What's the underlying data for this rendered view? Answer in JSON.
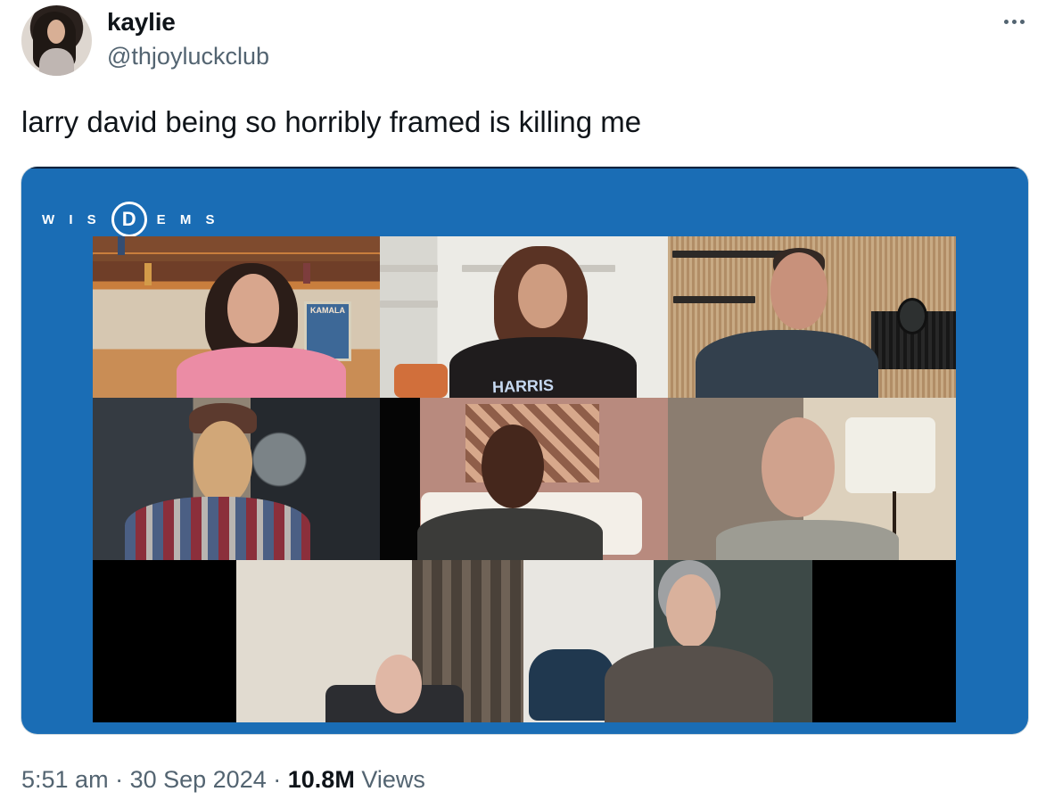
{
  "tweet": {
    "author_name": "kaylie",
    "author_handle": "@thjoyluckclub",
    "text": "larry david being so horribly framed is killing me",
    "time": "5:51 am",
    "separator": "·",
    "date": "30 Sep 2024",
    "views_count": "10.8M",
    "views_label": "Views"
  },
  "media": {
    "brand_prefix": "W I S",
    "brand_mark": "D",
    "brand_suffix": "E M S",
    "shirt_text": "HARRIS",
    "poster_text": "KAMALA"
  },
  "colors": {
    "media_background": "#1a6db5",
    "secondary_text": "#536471"
  },
  "icons": [
    "more-options-icon"
  ]
}
